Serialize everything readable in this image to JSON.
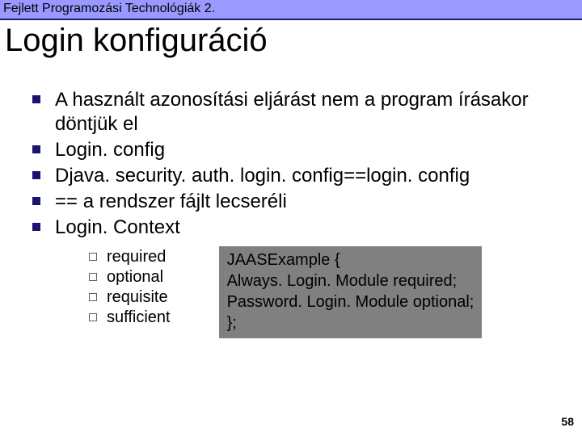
{
  "header": "Fejlett Programozási Technológiák 2.",
  "title": "Login konfiguráció",
  "bullets": {
    "b1": "A használt azonosítási eljárást nem a program írásakor döntjük el",
    "b2": "Login. config",
    "b3": "Djava. security. auth. login. config==login. config",
    "b4": "== a rendszer fájlt lecseréli",
    "b5": "Login. Context"
  },
  "sub": {
    "s1": "required",
    "s2": "optional",
    "s3": "requisite",
    "s4": "sufficient"
  },
  "code": "JAASExample {\nAlways. Login. Module required;\nPassword. Login. Module optional;\n};",
  "page": "58"
}
